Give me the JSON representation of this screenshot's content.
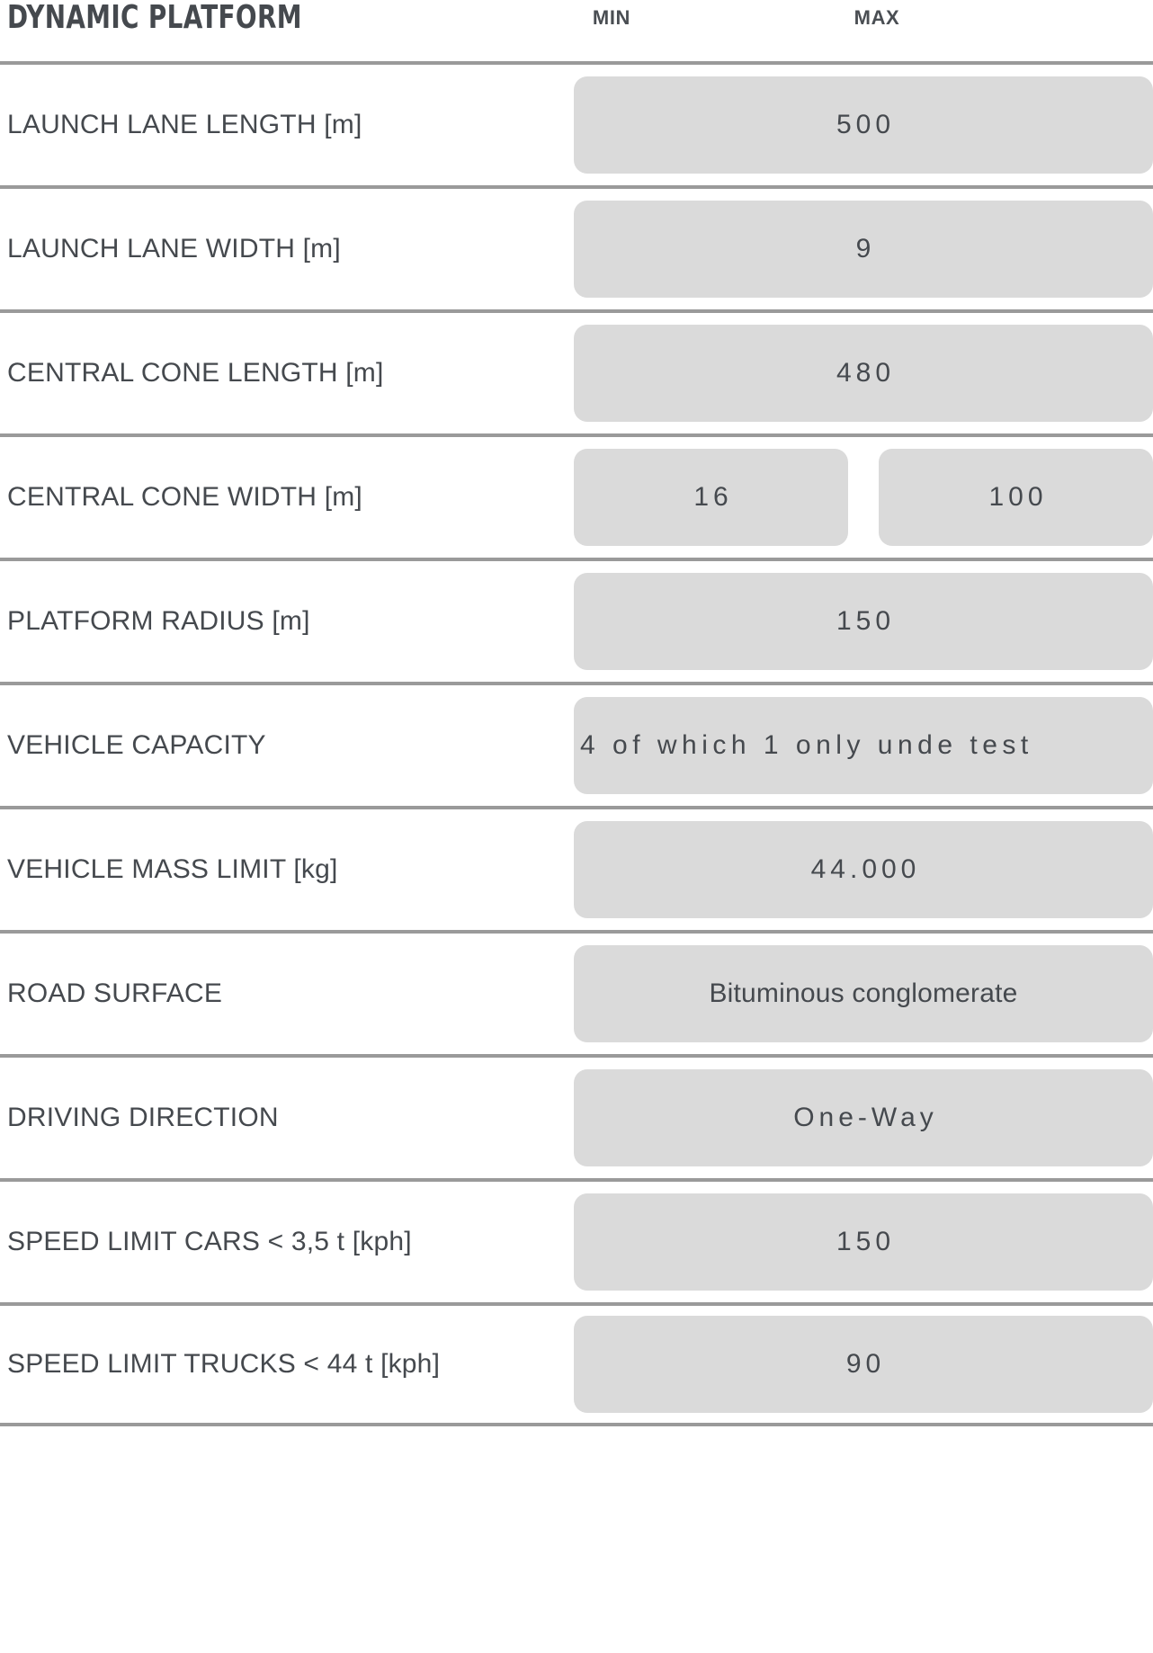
{
  "table": {
    "title": "DYNAMIC PLATFORM",
    "columns": {
      "min": "MIN",
      "max": "MAX"
    },
    "colors": {
      "text": "#45494E",
      "pill_fill": "#DADADA",
      "divider": "#9A9A9A",
      "background": "#FFFFFF"
    },
    "rows": [
      {
        "label": "LAUNCH LANE LENGTH [m]",
        "span": true,
        "value": "500"
      },
      {
        "label": "LAUNCH LANE WIDTH [m]",
        "span": true,
        "value": "9"
      },
      {
        "label": "CENTRAL CONE LENGTH [m]",
        "span": true,
        "value": "480"
      },
      {
        "label": "CENTRAL CONE WIDTH [m]",
        "span": false,
        "min": "16",
        "max": "100"
      },
      {
        "label": "PLATFORM RADIUS [m]",
        "span": true,
        "value": "150"
      },
      {
        "label": "VEHICLE CAPACITY",
        "span": true,
        "value": "4 of which 1 only unde test"
      },
      {
        "label": "VEHICLE MASS LIMIT [kg]",
        "span": true,
        "value": "44.000"
      },
      {
        "label": "ROAD SURFACE",
        "span": true,
        "value": "Bituminous conglomerate"
      },
      {
        "label": "DRIVING DIRECTION",
        "span": true,
        "value": "One-Way"
      },
      {
        "label": "SPEED LIMIT CARS < 3,5 t [kph]",
        "span": true,
        "value": "150"
      },
      {
        "label": "SPEED LIMIT TRUCKS < 44 t [kph]",
        "span": true,
        "value": "90"
      }
    ]
  }
}
